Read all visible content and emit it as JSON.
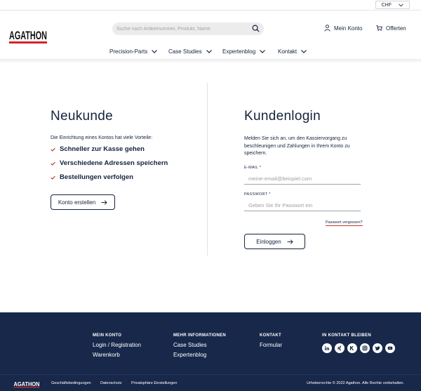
{
  "topbar": {
    "currency": "CHF"
  },
  "header": {
    "search_placeholder": "Suche nach Artikelnummer, Produkt, Name",
    "account_label": "Mein Konto",
    "offers_label": "Offerten"
  },
  "nav": {
    "items": [
      {
        "label": "Precision-Parts"
      },
      {
        "label": "Case Studies"
      },
      {
        "label": "Expertenblog"
      },
      {
        "label": "Kontakt"
      }
    ]
  },
  "register": {
    "title": "Neukunde",
    "intro": "Die Einrichtung eines Kontos hat viele Vorteile:",
    "benefits": [
      "Schneller zur Kasse gehen",
      "Verschiedene Adressen speichern",
      "Bestellungen verfolgen"
    ],
    "button_label": "Konto erstellen"
  },
  "login": {
    "title": "Kundenlogin",
    "description": "Melden Sie sich an, um den Kassiervorgang zu beschleunigen und Zahlungen in Ihrem Konto zu speichern.",
    "email_label": "E-MAIL *",
    "email_placeholder": "meine-email@beispiel.com",
    "password_label": "PASSWORT *",
    "password_placeholder": "Geben Sie Ihr Passwort ein",
    "forgot_label": "Passwort vergessen?",
    "button_label": "Einloggen"
  },
  "footer": {
    "account": {
      "heading": "MEIN KONTO",
      "links": [
        "Login / Registration",
        "Warenkorb"
      ]
    },
    "info": {
      "heading": "MEHR INFORMATIONEN",
      "links": [
        "Case Studies",
        "Expertenblog"
      ]
    },
    "contact": {
      "heading": "KONTAKT",
      "links": [
        "Formular"
      ]
    },
    "social": {
      "heading": "IN KONTAKT BLEIBEN",
      "icons": [
        "linkedin-icon",
        "xing-icon",
        "kununu-icon",
        "instagram-icon",
        "twitter-icon",
        "youtube-icon"
      ]
    },
    "bottom_links": [
      "Geschäftsbedingungen",
      "Datenschutz",
      "Privatsphäre Einstellungen"
    ],
    "copyright": "Urheberrechte © 2022 Agathon. Alle Rechte vorbehalten."
  },
  "colors": {
    "navy": "#17284a",
    "text": "#14233c",
    "accent_red": "#c0392b",
    "brand_red": "#d2232a"
  }
}
